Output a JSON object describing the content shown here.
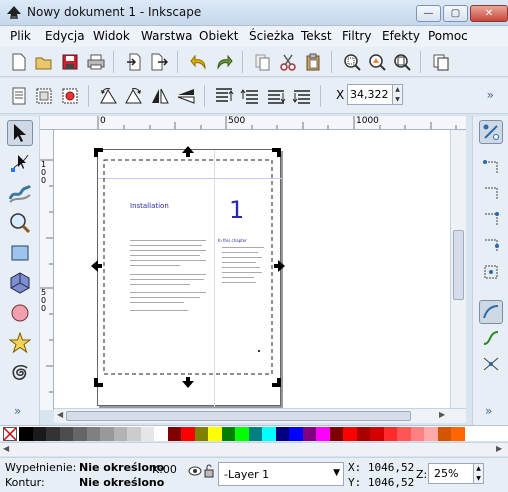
{
  "window": {
    "title": "Nowy dokument 1 - Inkscape",
    "min_label": "—",
    "max_label": "▢",
    "close_label": "✕"
  },
  "menu": [
    "Plik",
    "Edycja",
    "Widok",
    "Warstwa",
    "Obiekt",
    "Ścieżka",
    "Tekst",
    "Filtry",
    "Efekty",
    "Pomoc"
  ],
  "toolbar2": {
    "x_label": "X",
    "x_value": "34,322",
    "more": "»"
  },
  "toolbar1": {
    "more": "»"
  },
  "ruler": {
    "top_ticks": [
      "0",
      "500",
      "1000"
    ],
    "left_ticks": [
      "100",
      "500"
    ]
  },
  "document": {
    "heading": "Installation",
    "page_number": "1",
    "section_heading": "In this chapter"
  },
  "palette": {
    "colors": [
      "#000000",
      "#1a1a1a",
      "#333333",
      "#4d4d4d",
      "#666666",
      "#808080",
      "#999999",
      "#b3b3b3",
      "#cccccc",
      "#e6e6e6",
      "#ffffff",
      "#800000",
      "#ff0000",
      "#808000",
      "#ffff00",
      "#008000",
      "#00ff00",
      "#008080",
      "#00ffff",
      "#000080",
      "#0000ff",
      "#800080",
      "#ff00ff",
      "#800000",
      "#ff0000",
      "#aa0000",
      "#d40000",
      "#ff2a2a",
      "#ff5555",
      "#ff8080",
      "#ffaaaa",
      "#d45500",
      "#ff6600"
    ]
  },
  "status": {
    "fill_label": "Wypełnienie:",
    "fill_value": "Nie określono",
    "stroke_label": "Kontur:",
    "stroke_value": "Nie określono",
    "opacity_label": "K:",
    "opacity_value": "00",
    "layer": "-Layer 1",
    "x": "X: 1046,52",
    "y": "Y: 1046,52",
    "zoom_label": "Z:",
    "zoom_value": "25%"
  },
  "snapbar": {
    "more": "»"
  },
  "toolbox": {
    "more": "»"
  }
}
